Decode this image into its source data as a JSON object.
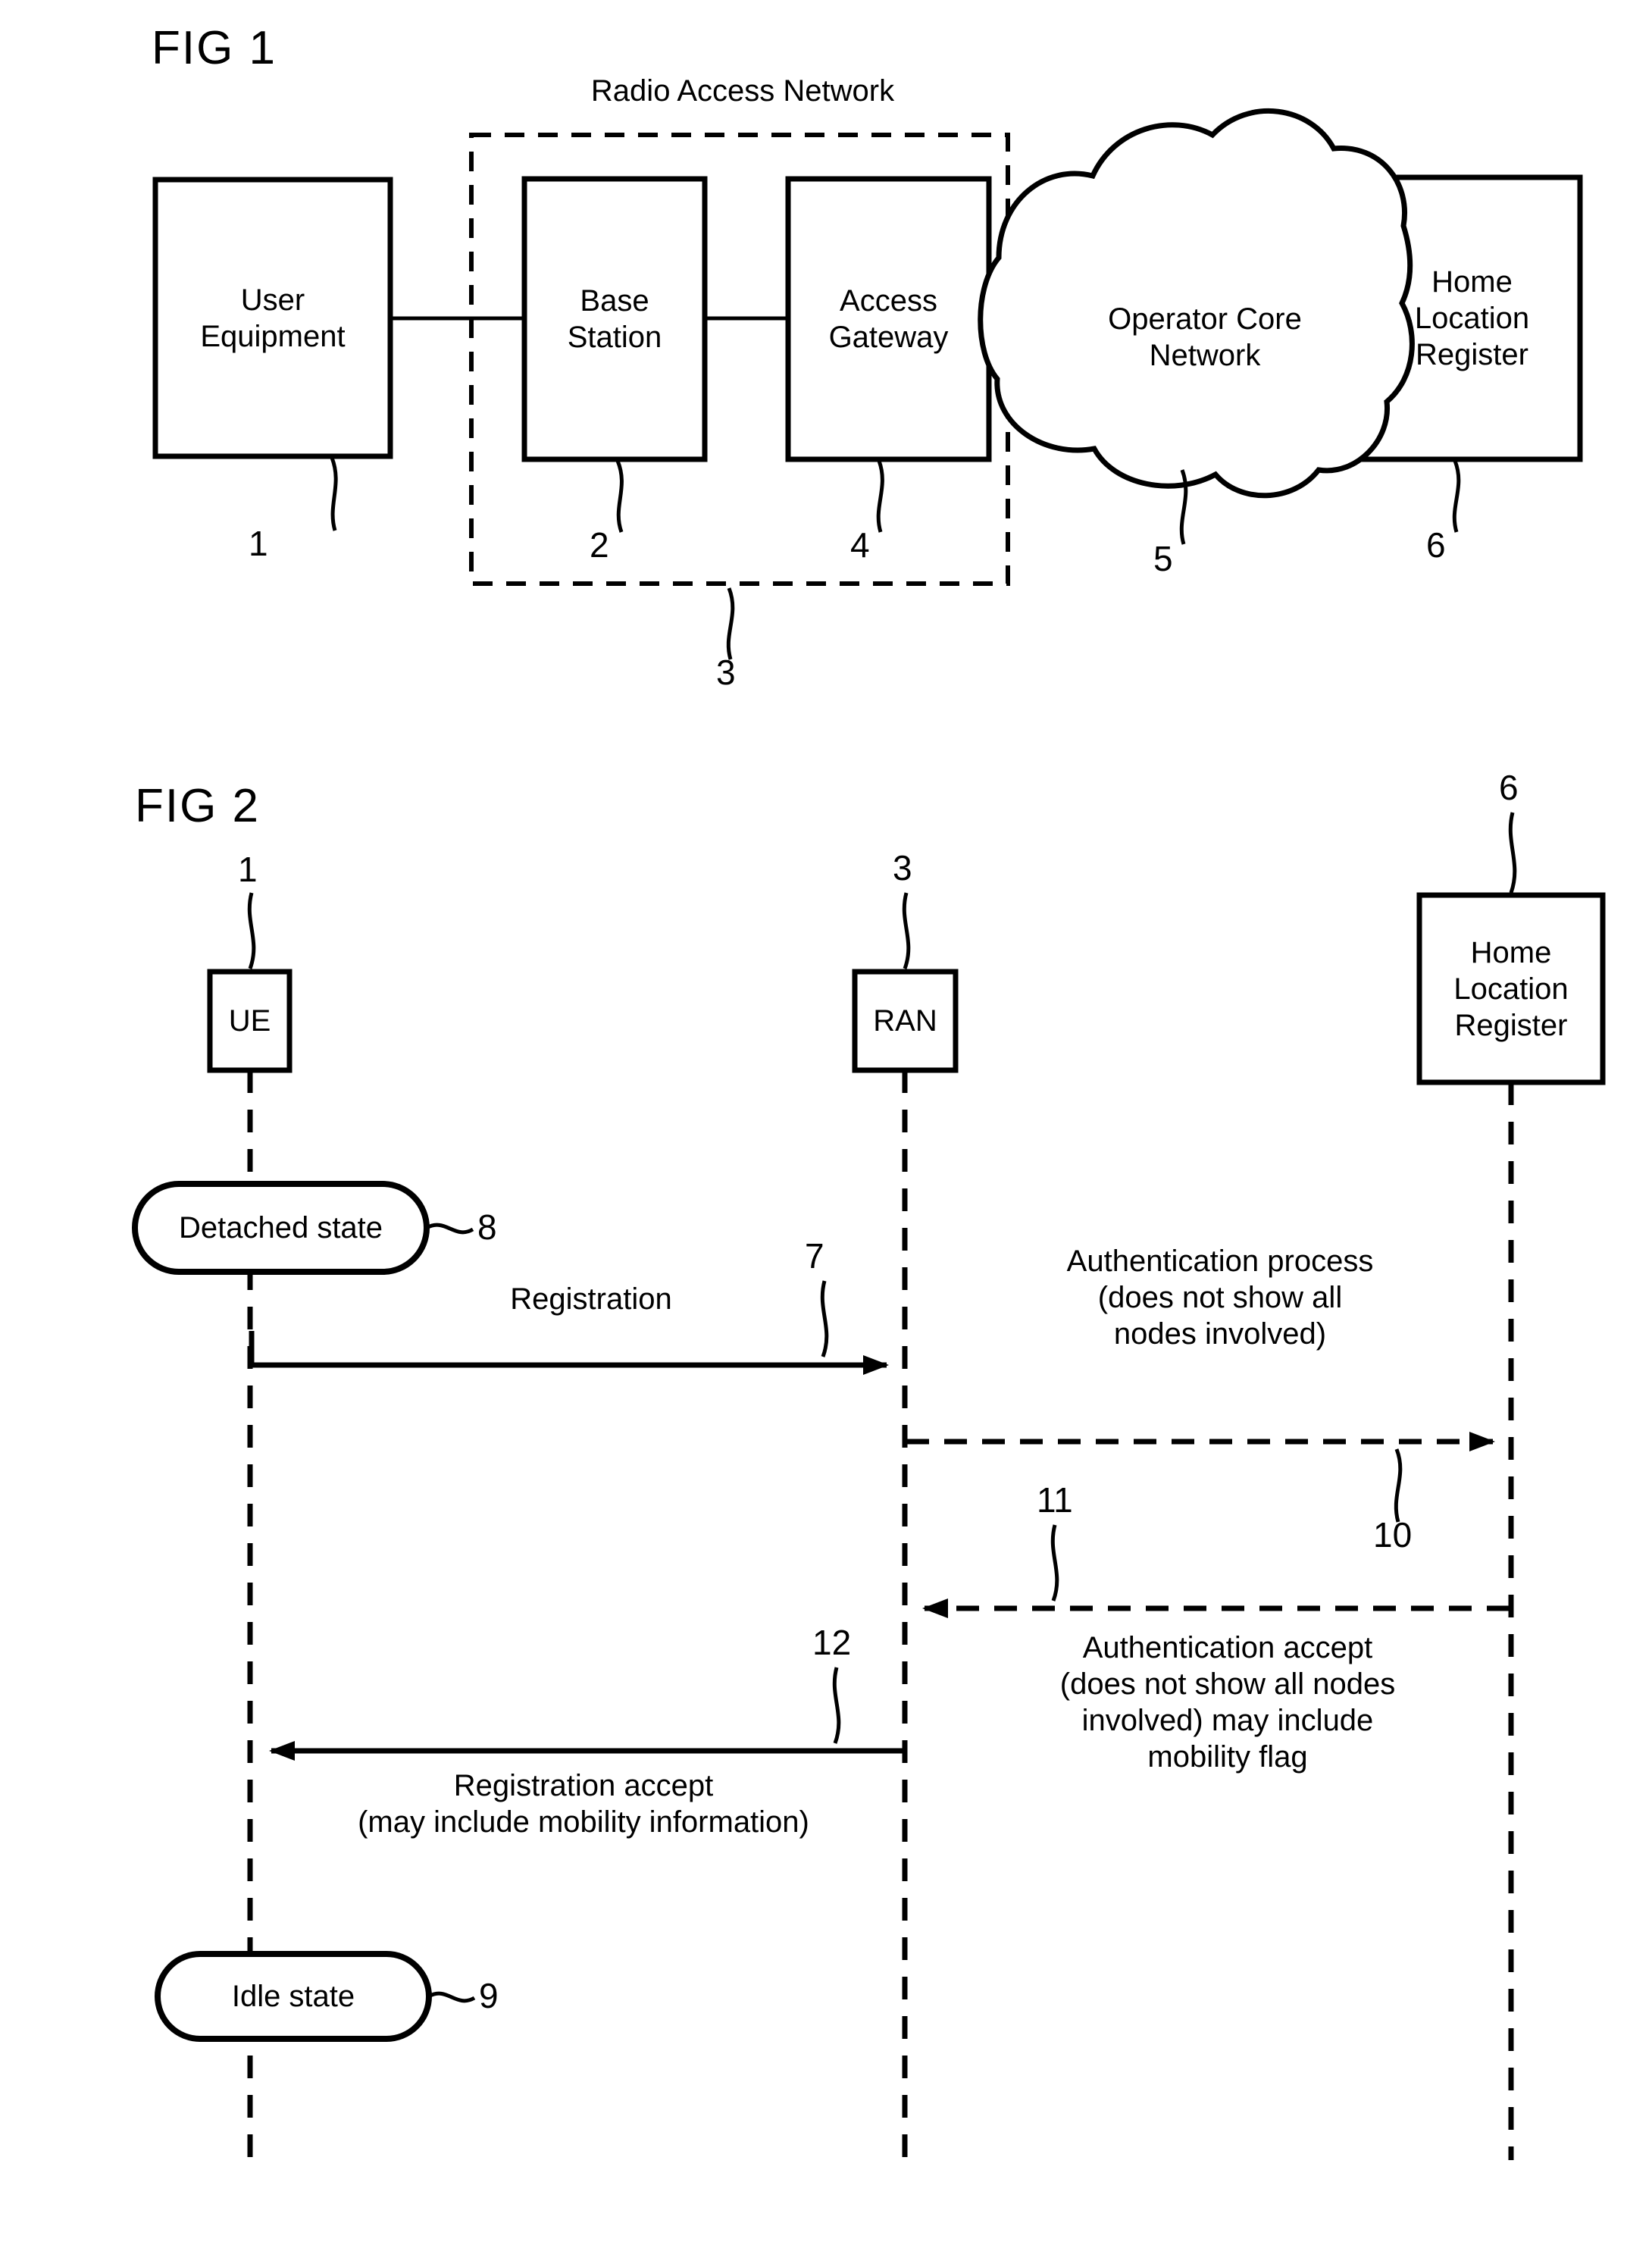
{
  "figures": [
    {
      "id": "fig1",
      "title": "FIG 1",
      "group_label": "Radio Access Network",
      "nodes": [
        {
          "key": "ue",
          "label": "User\nEquipment",
          "ref": "1"
        },
        {
          "key": "bs",
          "label": "Base\nStation",
          "ref": "2"
        },
        {
          "key": "ran",
          "label": "Radio Access Network",
          "ref": "3"
        },
        {
          "key": "ag",
          "label": "Access\nGateway",
          "ref": "4"
        },
        {
          "key": "ocn",
          "label": "Operator Core\nNetwork",
          "ref": "5"
        },
        {
          "key": "hlr",
          "label": "Home\nLocation\nRegister",
          "ref": "6"
        }
      ],
      "node_labels": {
        "user_equipment_line1": "User",
        "user_equipment_line2": "Equipment",
        "base_station_line1": "Base",
        "base_station_line2": "Station",
        "access_gateway_line1": "Access",
        "access_gateway_line2": "Gateway",
        "operator_core_network_line1": "Operator Core",
        "operator_core_network_line2": "Network",
        "home_location_register_line1": "Home",
        "home_location_register_line2": "Location",
        "home_location_register_line3": "Register"
      },
      "refs": {
        "ue": "1",
        "bs": "2",
        "ran": "3",
        "ag": "4",
        "ocn": "5",
        "hlr": "6"
      }
    },
    {
      "id": "fig2",
      "title": "FIG 2",
      "lifelines": [
        {
          "key": "ue",
          "label": "UE",
          "ref": "1"
        },
        {
          "key": "ran",
          "label": "RAN",
          "ref": "3"
        },
        {
          "key": "hlr",
          "label": "Home\nLocation\nRegister",
          "ref": "6"
        }
      ],
      "lifeline_labels": {
        "ue": "UE",
        "ran": "RAN",
        "hlr_line1": "Home",
        "hlr_line2": "Location",
        "hlr_line3": "Register"
      },
      "lifeline_refs": {
        "ue": "1",
        "ran": "3",
        "hlr": "6"
      },
      "states": [
        {
          "key": "detached",
          "label": "Detached state",
          "ref": "8"
        },
        {
          "key": "idle",
          "label": "Idle state",
          "ref": "9"
        }
      ],
      "state_labels": {
        "detached": "Detached state",
        "idle": "Idle state"
      },
      "state_refs": {
        "detached": "8",
        "idle": "9"
      },
      "messages": [
        {
          "key": "registration",
          "label": "Registration",
          "ref": "7",
          "from": "ue",
          "to": "ran",
          "style": "solid",
          "direction": "right"
        },
        {
          "key": "auth_process",
          "label": "Authentication process\n(does not show all\nnodes involved)",
          "ref": "10",
          "from": "ran",
          "to": "hlr",
          "style": "dashed",
          "direction": "right"
        },
        {
          "key": "auth_accept",
          "label": "Authentication accept\n(does not show all nodes\ninvolved) may include\nmobility flag",
          "ref": "11",
          "from": "hlr",
          "to": "ran",
          "style": "dashed",
          "direction": "left"
        },
        {
          "key": "registration_accept",
          "label": "Registration accept\n(may include mobility information)",
          "ref": "12",
          "from": "ran",
          "to": "ue",
          "style": "solid",
          "direction": "left"
        }
      ],
      "message_labels": {
        "registration": "Registration",
        "auth_process_line1": "Authentication process",
        "auth_process_line2": "(does not show all",
        "auth_process_line3": "nodes involved)",
        "auth_accept_line1": "Authentication accept",
        "auth_accept_line2": "(does not show all nodes",
        "auth_accept_line3": "involved) may include",
        "auth_accept_line4": "mobility flag",
        "registration_accept_line1": "Registration accept",
        "registration_accept_line2": "(may include mobility information)"
      },
      "message_refs": {
        "registration": "7",
        "auth_process": "10",
        "auth_accept": "11",
        "registration_accept": "12"
      }
    }
  ],
  "colors": {
    "ink": "#000000",
    "paper": "#ffffff"
  }
}
